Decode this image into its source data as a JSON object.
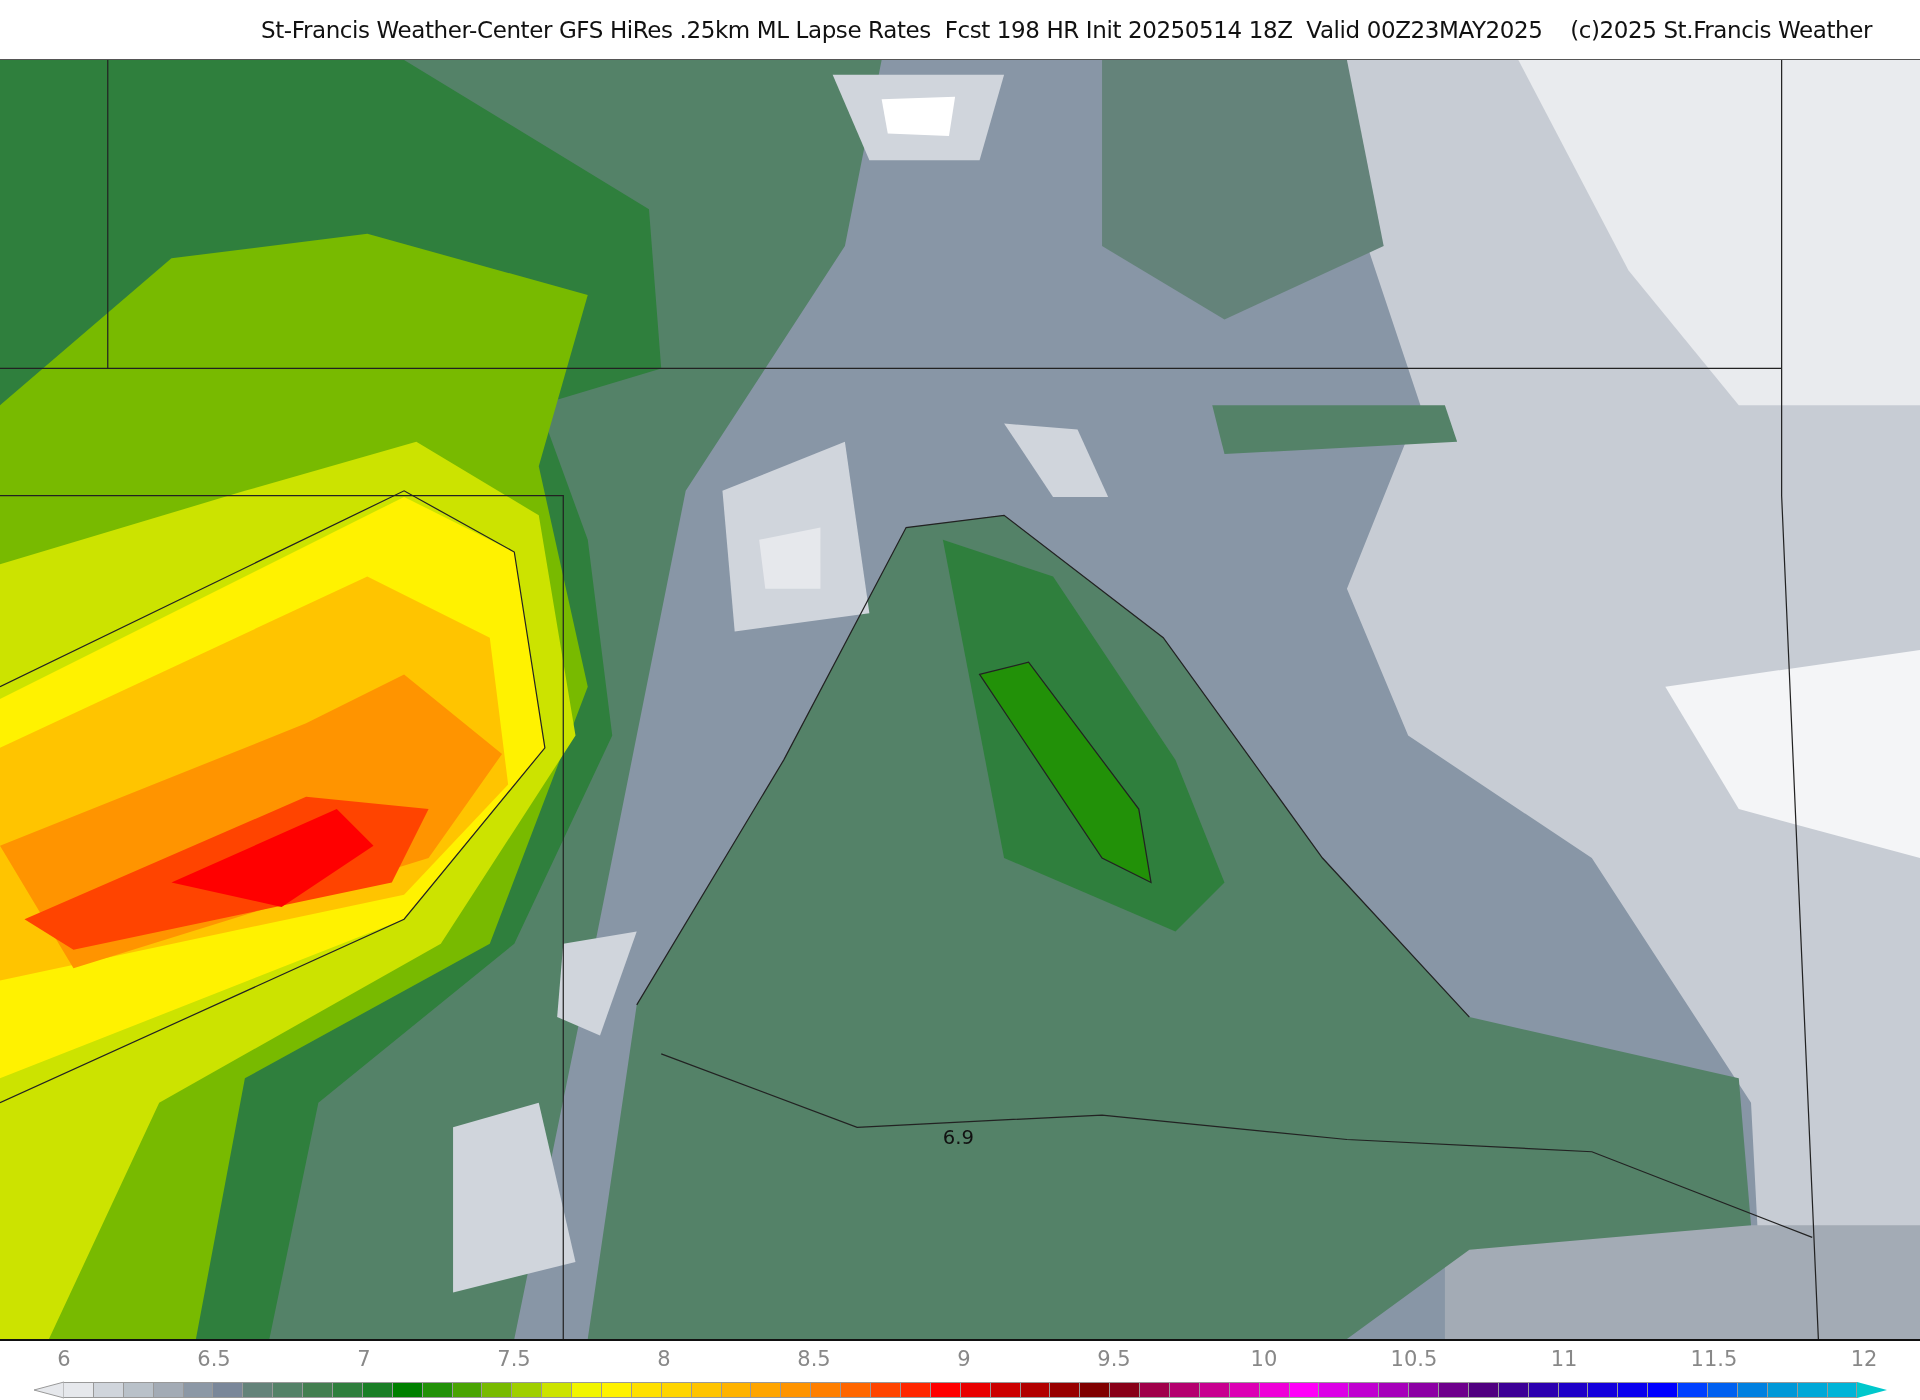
{
  "title": "St-Francis Weather-Center GFS HiRes .25km ML Lapse Rates  Fcst 198 HR Init 20250514 18Z  Valid 00Z23MAY2025    (c)2025 St.Francis Weather",
  "map": {
    "contour_labels": [
      "6.9"
    ]
  },
  "colorbar": {
    "ticks": [
      "6",
      "6.5",
      "7",
      "7.5",
      "8",
      "8.5",
      "9",
      "9.5",
      "10",
      "10.5",
      "11",
      "11.5",
      "12"
    ],
    "under_arrow": {
      "color": "#e6e8ec"
    },
    "over_arrow": {
      "color": "#00c8cc"
    },
    "swatches": [
      {
        "color": "#e6e8ec"
      },
      {
        "color": "#d0d5dc"
      },
      {
        "color": "#b9c1c9"
      },
      {
        "color": "#a3abb5"
      },
      {
        "color": "#8c98a6"
      },
      {
        "color": "#7a879a"
      },
      {
        "color": "#64837a"
      },
      {
        "color": "#548268"
      },
      {
        "color": "#437f50"
      },
      {
        "color": "#2f7f3d"
      },
      {
        "color": "#1a7f26"
      },
      {
        "color": "#008000"
      },
      {
        "color": "#229108"
      },
      {
        "color": "#4aa403"
      },
      {
        "color": "#78ba00"
      },
      {
        "color": "#a0cf00"
      },
      {
        "color": "#cce300"
      },
      {
        "color": "#f2f500"
      },
      {
        "color": "#fff200"
      },
      {
        "color": "#ffe000"
      },
      {
        "color": "#ffd500"
      },
      {
        "color": "#ffc400"
      },
      {
        "color": "#ffb300"
      },
      {
        "color": "#ffa500"
      },
      {
        "color": "#ff9400"
      },
      {
        "color": "#ff7f00"
      },
      {
        "color": "#ff6600"
      },
      {
        "color": "#ff4400"
      },
      {
        "color": "#ff2600"
      },
      {
        "color": "#ff0000"
      },
      {
        "color": "#e80000"
      },
      {
        "color": "#cc0000"
      },
      {
        "color": "#b20000"
      },
      {
        "color": "#990000"
      },
      {
        "color": "#800000"
      },
      {
        "color": "#880018"
      },
      {
        "color": "#a0004a"
      },
      {
        "color": "#b4006e"
      },
      {
        "color": "#c80090"
      },
      {
        "color": "#dc00b4"
      },
      {
        "color": "#ee00d8"
      },
      {
        "color": "#ff00f8"
      },
      {
        "color": "#dc00e6"
      },
      {
        "color": "#c000d0"
      },
      {
        "color": "#a600ba"
      },
      {
        "color": "#8c00a4"
      },
      {
        "color": "#6e008c"
      },
      {
        "color": "#500080"
      },
      {
        "color": "#3c0096"
      },
      {
        "color": "#2c00b0"
      },
      {
        "color": "#1e00c8"
      },
      {
        "color": "#1400dc"
      },
      {
        "color": "#0a00ee"
      },
      {
        "color": "#0000ff"
      },
      {
        "color": "#0040ff"
      },
      {
        "color": "#0060f0"
      },
      {
        "color": "#0080e0"
      },
      {
        "color": "#0098d8"
      },
      {
        "color": "#00a8d8"
      },
      {
        "color": "#00b4d8"
      }
    ]
  }
}
